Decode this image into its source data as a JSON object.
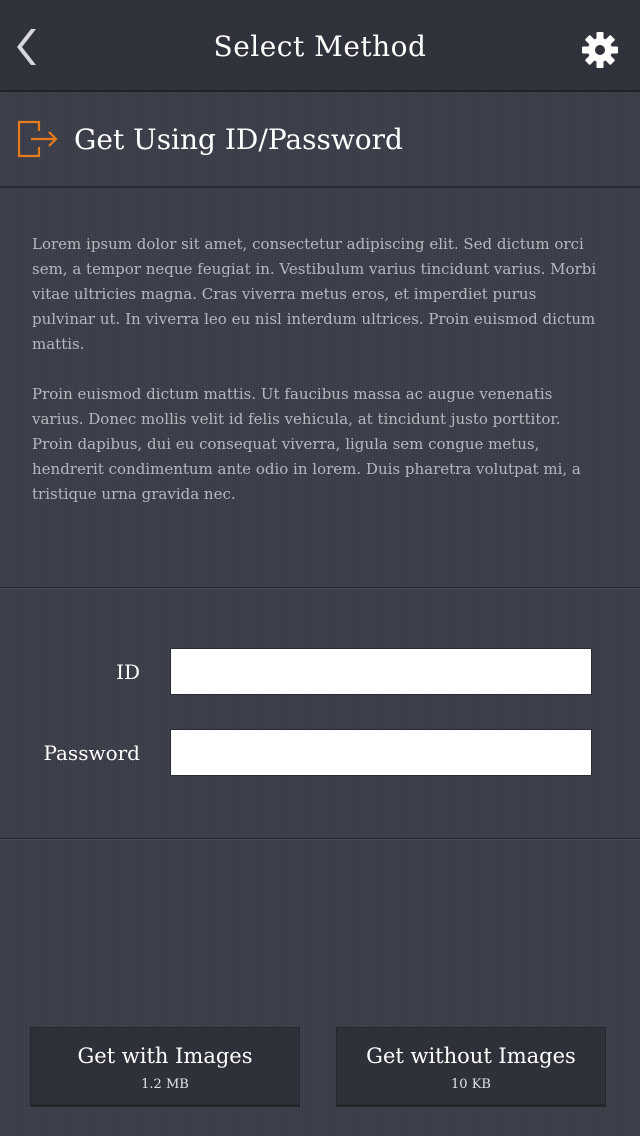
{
  "header": {
    "title": "Select Method",
    "back_icon": "chevron-left-icon",
    "settings_icon": "gear-icon"
  },
  "section": {
    "icon": "logout-icon",
    "title": "Get Using ID/Password",
    "accent_color": "#e87a1e"
  },
  "description": {
    "paragraphs": [
      "Lorem ipsum dolor sit amet, consectetur adipiscing elit. Sed dictum orci sem, a tempor neque feugiat in. Vestibulum varius tincidunt varius. Morbi vitae ultricies magna. Cras viverra metus eros, et imperdiet purus pulvinar ut. In viverra leo eu nisl interdum ultrices. Proin euismod dictum mattis.",
      "Proin euismod dictum mattis. Ut faucibus massa ac augue venenatis varius. Donec mollis velit id felis vehicula, at tincidunt justo porttitor. Proin dapibus, dui eu consequat viverra, ligula sem congue metus, hendrerit condimentum ante odio in lorem. Duis pharetra volutpat mi, a tristique urna gravida nec."
    ]
  },
  "form": {
    "id_label": "ID",
    "id_value": "",
    "password_label": "Password",
    "password_value": ""
  },
  "buttons": {
    "with_images": {
      "label": "Get with Images",
      "size": "1.2 MB"
    },
    "without_images": {
      "label": "Get without Images",
      "size": "10 KB"
    }
  },
  "colors": {
    "background": "#3a3d48",
    "header": "#2e3039",
    "button": "#2f313a",
    "text_muted": "#b6b8c0"
  }
}
